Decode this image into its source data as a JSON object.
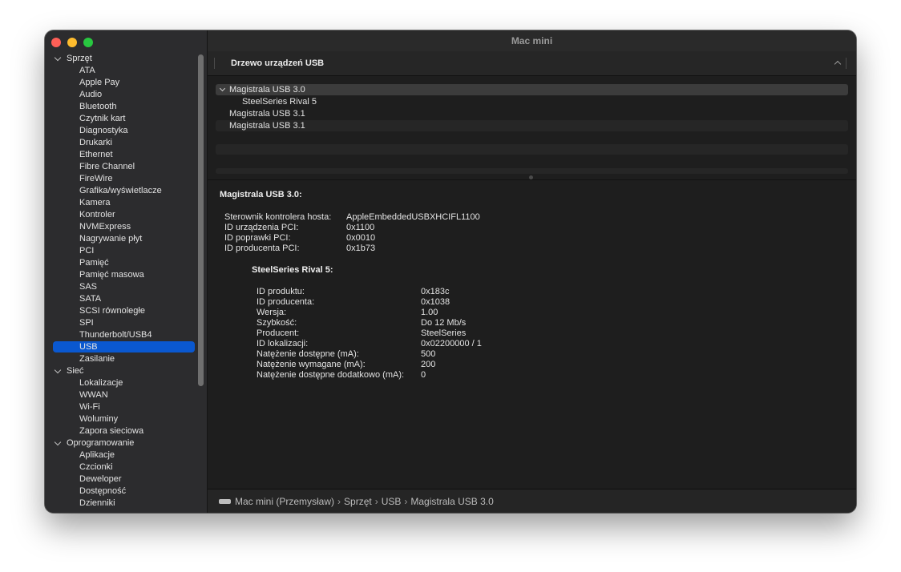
{
  "window": {
    "title": "Mac mini"
  },
  "sidebar": {
    "groups": [
      {
        "label": "Sprzęt",
        "items": [
          "ATA",
          "Apple Pay",
          "Audio",
          "Bluetooth",
          "Czytnik kart",
          "Diagnostyka",
          "Drukarki",
          "Ethernet",
          "Fibre Channel",
          "FireWire",
          "Grafika/wyświetlacze",
          "Kamera",
          "Kontroler",
          "NVMExpress",
          "Nagrywanie płyt",
          "PCI",
          "Pamięć",
          "Pamięć masowa",
          "SAS",
          "SATA",
          "SCSI równoległe",
          "SPI",
          "Thunderbolt/USB4",
          "USB",
          "Zasilanie"
        ]
      },
      {
        "label": "Sieć",
        "items": [
          "Lokalizacje",
          "WWAN",
          "Wi-Fi",
          "Woluminy",
          "Zapora sieciowa"
        ]
      },
      {
        "label": "Oprogramowanie",
        "items": [
          "Aplikacje",
          "Czcionki",
          "Deweloper",
          "Dostępność",
          "Dzienniki"
        ]
      }
    ],
    "selected_item": "USB"
  },
  "tree_header": "Drzewo urządzeń USB",
  "usb_tree": [
    {
      "label": "Magistrala USB 3.0",
      "expanded": true,
      "selected": true
    },
    {
      "label": "SteelSeries Rival 5",
      "child": true
    },
    {
      "label": "Magistrala USB 3.1"
    },
    {
      "label": "Magistrala USB 3.1"
    }
  ],
  "details": {
    "title": "Magistrala USB 3.0:",
    "host": [
      {
        "k": "Sterownik kontrolera hosta:",
        "v": "AppleEmbeddedUSBXHCIFL1100"
      },
      {
        "k": "ID urządzenia PCI:",
        "v": "0x1100"
      },
      {
        "k": "ID poprawki PCI:",
        "v": "0x0010"
      },
      {
        "k": "ID producenta PCI:",
        "v": "0x1b73"
      }
    ],
    "device_title": "SteelSeries Rival 5:",
    "device": [
      {
        "k": "ID produktu:",
        "v": "0x183c"
      },
      {
        "k": "ID producenta:",
        "v": "0x1038"
      },
      {
        "k": "Wersja:",
        "v": "1.00"
      },
      {
        "k": "Szybkość:",
        "v": "Do 12 Mb/s"
      },
      {
        "k": "Producent:",
        "v": "SteelSeries"
      },
      {
        "k": "ID lokalizacji:",
        "v": "0x02200000 / 1"
      },
      {
        "k": "Natężenie dostępne (mA):",
        "v": "500"
      },
      {
        "k": "Natężenie wymagane (mA):",
        "v": "200"
      },
      {
        "k": "Natężenie dostępne dodatkowo (mA):",
        "v": "0"
      }
    ]
  },
  "pathbar": {
    "icon": "mac-mini-icon",
    "crumbs": [
      "Mac mini (Przemysław)",
      "Sprzęt",
      "USB",
      "Magistrala USB 3.0"
    ]
  }
}
